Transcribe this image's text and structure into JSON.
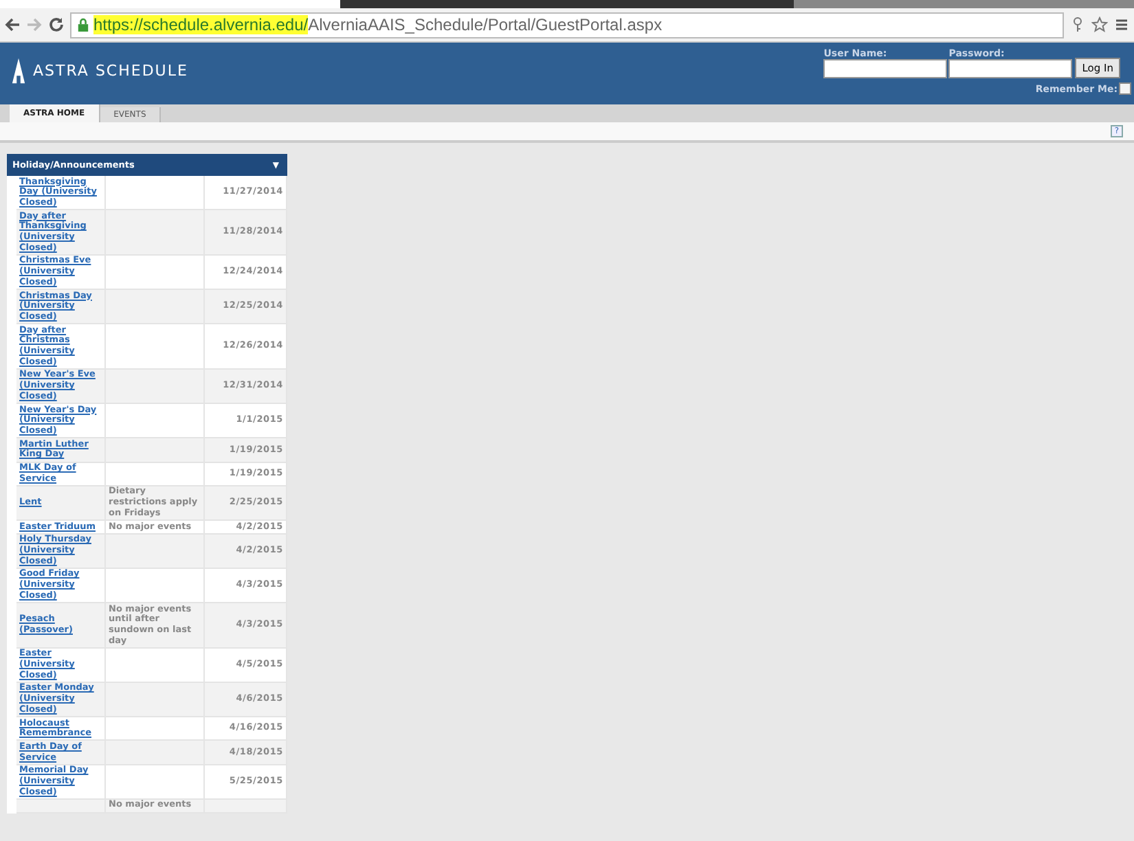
{
  "browser": {
    "url_highlighted": "https://schedule.alvernia.edu/",
    "url_rest": "AlverniaAAIS_Schedule/Portal/GuestPortal.aspx"
  },
  "header": {
    "title": "ASTRA SCHEDULE",
    "user_label": "User Name:",
    "password_label": "Password:",
    "login_button": "Log In",
    "remember_label": "Remember Me:",
    "remember_checked": false
  },
  "tabs": [
    {
      "label": "ASTRA HOME",
      "selected": true
    },
    {
      "label": "EVENTS",
      "selected": false
    }
  ],
  "help": "?",
  "panel": {
    "title": "Holiday/Announcements",
    "toggle": "▼",
    "rows": [
      {
        "name": "Thanksgiving Day (University Closed)",
        "date": "11/27/2014"
      },
      {
        "name": "Day after Thanksgiving (University Closed)",
        "date": "11/28/2014"
      },
      {
        "name": "Christmas Eve (University Closed)",
        "date": "12/24/2014"
      },
      {
        "name": "Christmas Day (University Closed)",
        "date": "12/25/2014"
      },
      {
        "name": "Day after Christmas (University Closed)",
        "date": "12/26/2014"
      },
      {
        "name": "New Year's Eve (University Closed)",
        "date": "12/31/2014"
      },
      {
        "name": "New Year's Day (University Closed)",
        "date": "1/1/2015"
      },
      {
        "name": "Martin Luther King Day",
        "date": "1/19/2015"
      },
      {
        "name": "MLK Day of Service",
        "date": "1/19/2015"
      },
      {
        "name": "Lent",
        "description": "Dietary restrictions apply on Fridays",
        "date": "2/25/2015"
      },
      {
        "name": "Easter Triduum",
        "description": "No major events",
        "date": "4/2/2015"
      },
      {
        "name": "Holy Thursday (University Closed)",
        "date": "4/2/2015"
      },
      {
        "name": "Good Friday (University Closed)",
        "date": "4/3/2015"
      },
      {
        "name": "Pesach (Passover)",
        "description": "No major events until after sundown on last day",
        "date": "4/3/2015"
      },
      {
        "name": "Easter (University Closed)",
        "date": "4/5/2015"
      },
      {
        "name": "Easter Monday (University Closed)",
        "date": "4/6/2015"
      },
      {
        "name": "Holocaust Remembrance",
        "date": "4/16/2015"
      },
      {
        "name": "Earth Day of Service",
        "date": "4/18/2015"
      },
      {
        "name": "Memorial Day (University Closed)",
        "date": "5/25/2015"
      },
      {
        "description": "No major events"
      }
    ]
  }
}
